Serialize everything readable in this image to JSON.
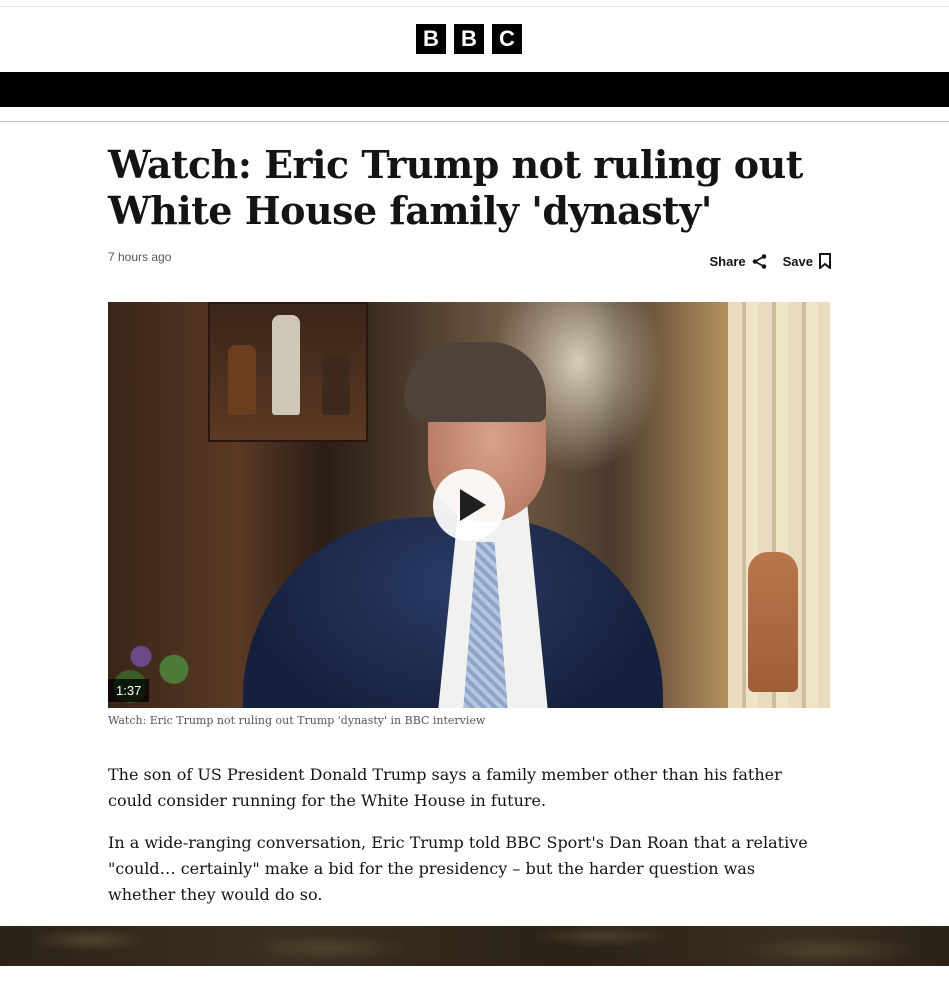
{
  "header": {
    "logo_letters": [
      "B",
      "B",
      "C"
    ]
  },
  "article": {
    "headline": "Watch: Eric Trump not ruling out White House family 'dynasty'",
    "timestamp": "7 hours ago",
    "actions": {
      "share_label": "Share",
      "save_label": "Save"
    },
    "video": {
      "duration": "1:37",
      "caption": "Watch: Eric Trump not ruling out Trump 'dynasty' in BBC interview"
    },
    "paragraphs": [
      "The son of US President Donald Trump says a family member other than his father could consider running for the White House in future.",
      "In a wide-ranging conversation, Eric Trump told BBC Sport's Dan Roan that a relative \"could… certainly\" make a bid for the presidency – but the harder question was whether they would do so."
    ]
  },
  "icons": {
    "share": "share-icon",
    "save": "bookmark-icon",
    "play": "play-icon"
  }
}
